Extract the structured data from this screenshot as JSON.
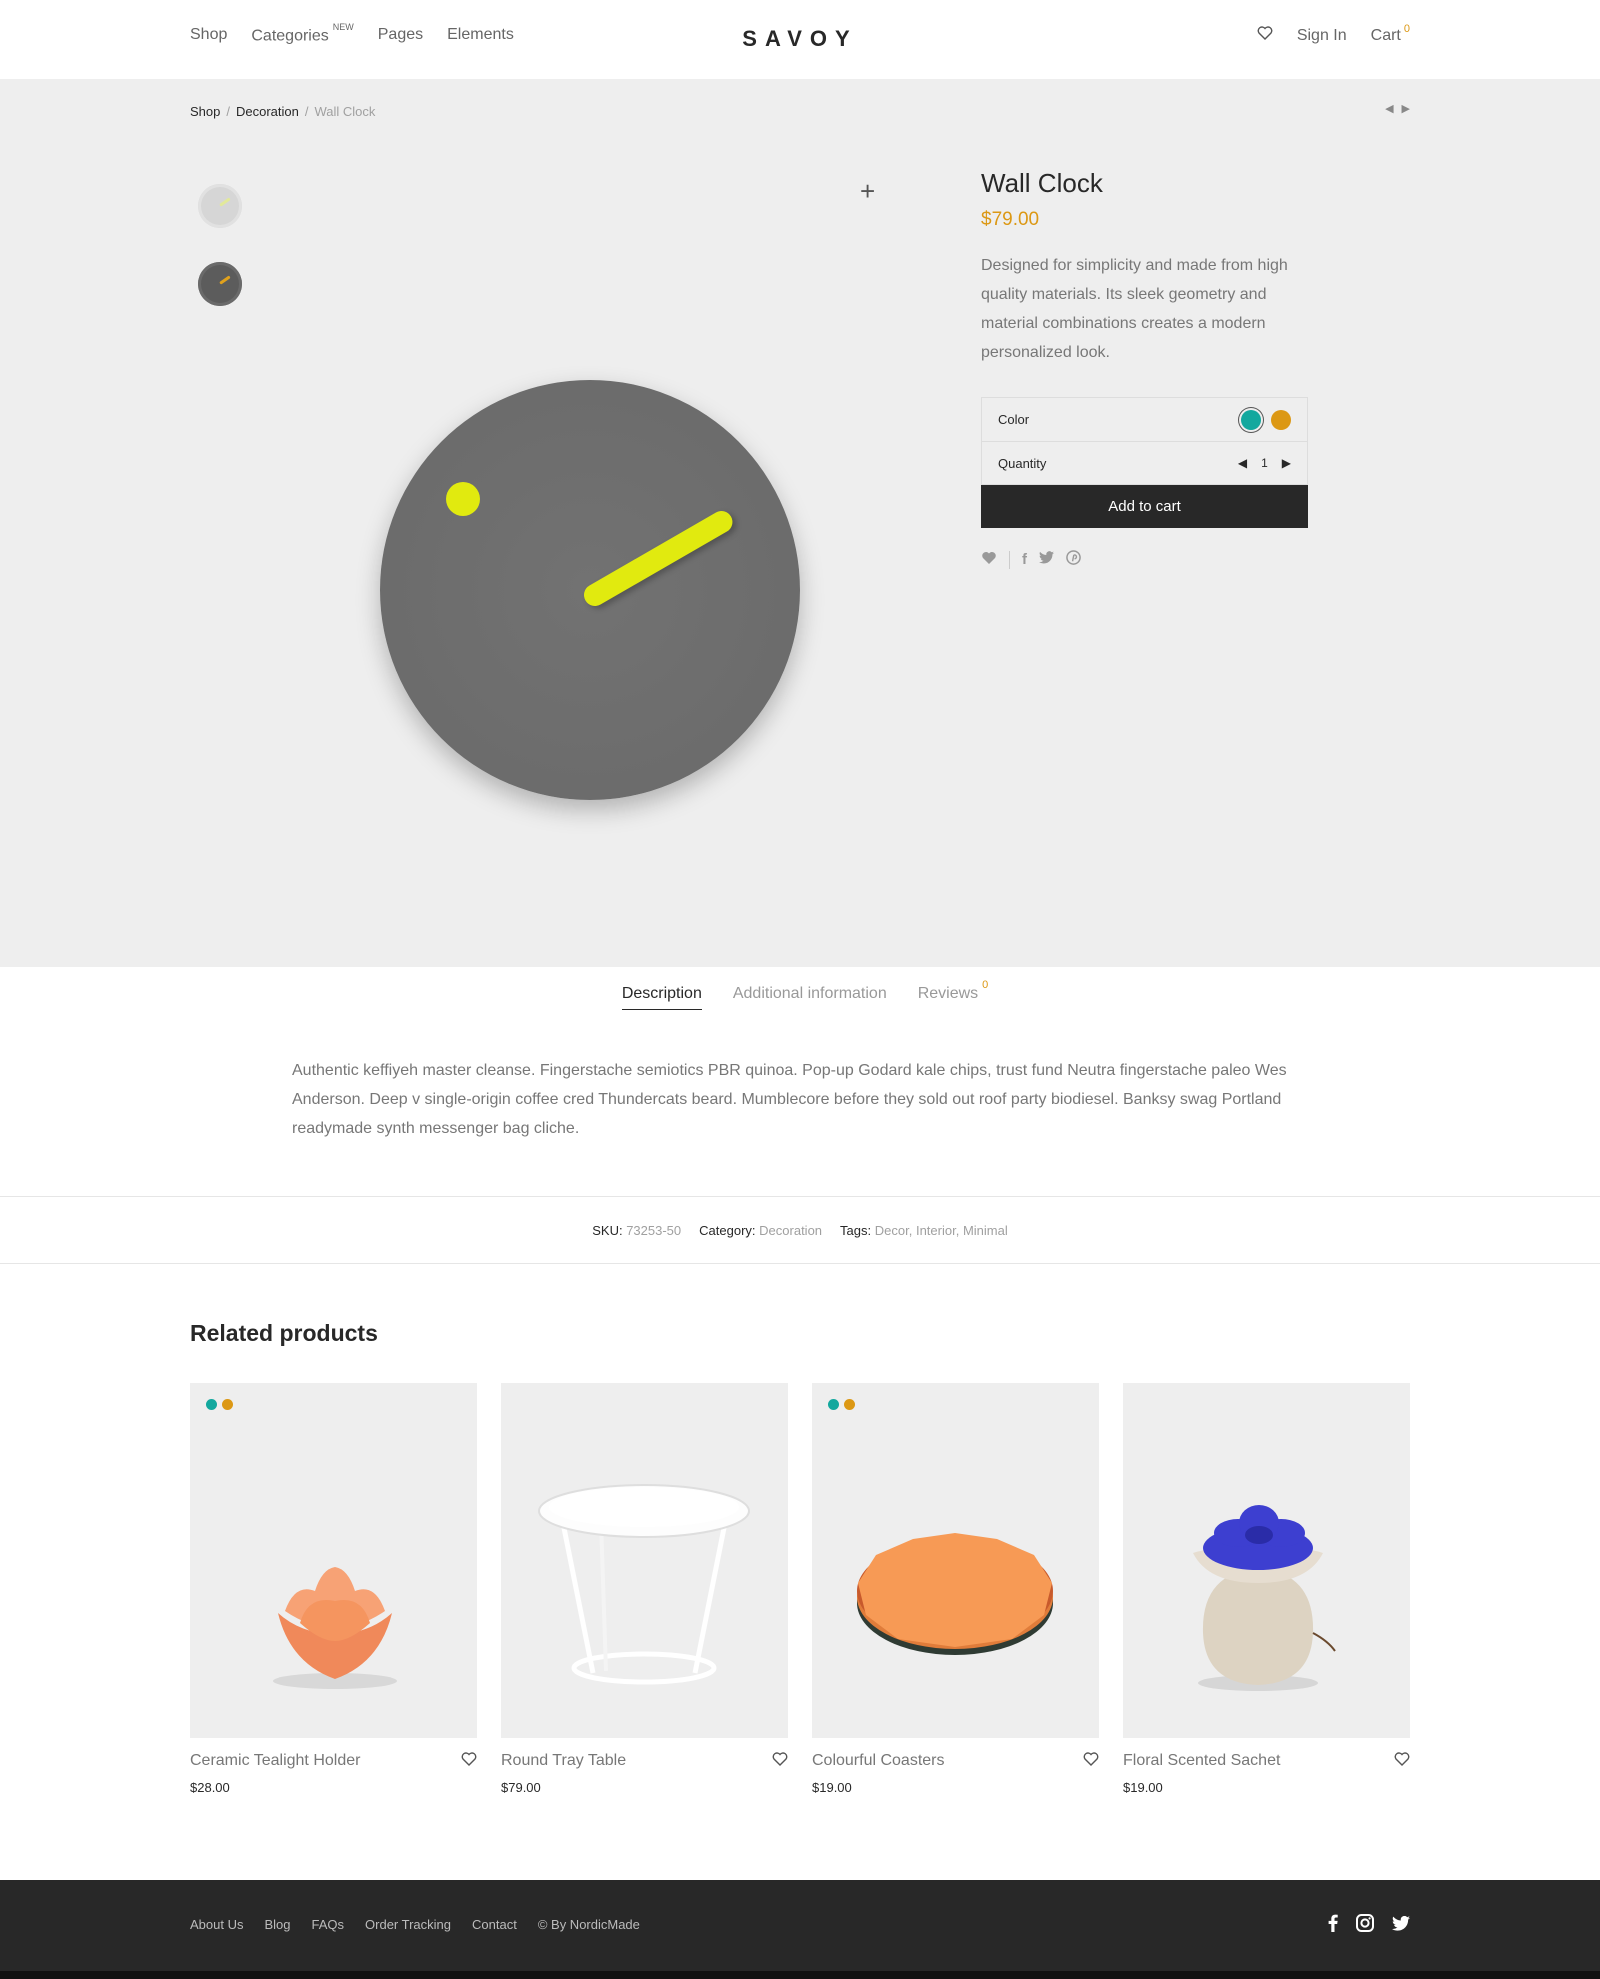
{
  "header": {
    "nav": [
      "Shop",
      "Categories",
      "Pages",
      "Elements"
    ],
    "categories_badge": "NEW",
    "logo": "SAVOY",
    "sign_in": "Sign In",
    "cart": "Cart",
    "cart_count": "0"
  },
  "breadcrumb": [
    "Shop",
    "Decoration",
    "Wall Clock"
  ],
  "breadcrumb_sep": "/",
  "product": {
    "title": "Wall Clock",
    "price": "$79.00",
    "description": "Designed for simplicity and made from high quality materials. Its sleek geometry and material combinations creates a modern personalized look.",
    "color_label": "Color",
    "colors": [
      "#13a89e",
      "#dc9814"
    ],
    "quantity_label": "Quantity",
    "quantity": "1",
    "add_to_cart": "Add to cart",
    "clock_colors": {
      "face": "#6b6b6b",
      "accent": "#e1ea0f"
    }
  },
  "tabs": {
    "items": [
      "Description",
      "Additional information",
      "Reviews"
    ],
    "reviews_count": "0",
    "description_text": "Authentic keffiyeh master cleanse. Fingerstache semiotics PBR quinoa. Pop-up Godard kale chips, trust fund Neutra fingerstache paleo Wes Anderson. Deep v single-origin coffee cred Thundercats beard. Mumblecore before they sold out roof party biodiesel. Banksy swag Portland readymade synth messenger bag cliche."
  },
  "meta": {
    "sku_label": "SKU:",
    "sku": "73253-50",
    "category_label": "Category:",
    "category": "Decoration",
    "tags_label": "Tags:",
    "tags": [
      "Decor",
      "Interior",
      "Minimal"
    ]
  },
  "related": {
    "title": "Related products",
    "items": [
      {
        "name": "Ceramic Tealight Holder",
        "price": "$28.00",
        "has_colors": true
      },
      {
        "name": "Round Tray Table",
        "price": "$79.00",
        "has_colors": false
      },
      {
        "name": "Colourful Coasters",
        "price": "$19.00",
        "has_colors": true
      },
      {
        "name": "Floral Scented Sachet",
        "price": "$19.00",
        "has_colors": false
      }
    ]
  },
  "footer": {
    "links": [
      "About Us",
      "Blog",
      "FAQs",
      "Order Tracking",
      "Contact"
    ],
    "copyright": "© By NordicMade",
    "social": [
      "facebook-icon",
      "instagram-icon",
      "twitter-icon"
    ]
  },
  "colors": {
    "accent": "#dc9814",
    "teal": "#13a89e",
    "dark": "#282828"
  }
}
